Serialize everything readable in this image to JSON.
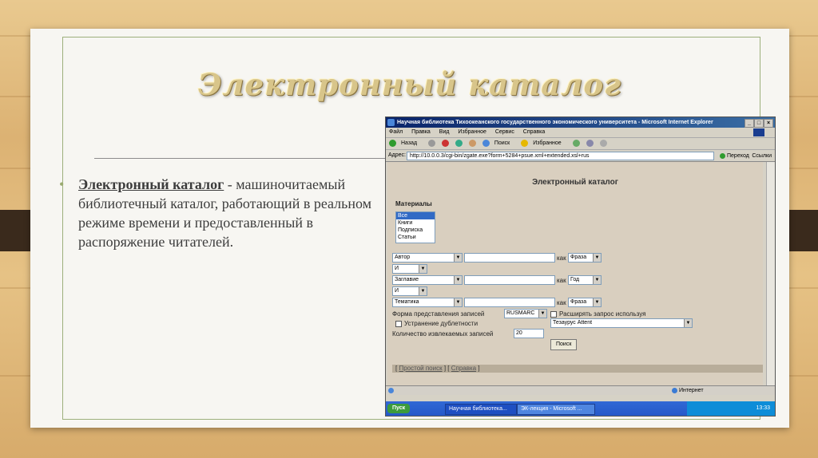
{
  "slide": {
    "title": "Электронный каталог",
    "bullet_term": "Электронный каталог",
    "bullet_text": " - машиночитаемый библиотечный каталог, работающий в реальном режиме времени и предоставленный в распоряжение читателей."
  },
  "browser": {
    "window_title": "Научная библиотека Тихоокеанского государственного экономического университета - Microsoft Internet Explorer",
    "window_buttons": [
      "_",
      "□",
      "×"
    ],
    "menu": [
      "Файл",
      "Правка",
      "Вид",
      "Избранное",
      "Сервис",
      "Справка"
    ],
    "toolbar": {
      "back": "Назад",
      "search": "Поиск",
      "favorites": "Избранное"
    },
    "address_label": "Адрес:",
    "address_value": "http://10.0.0.3/cgi-bin/zgate.exe?form+5284+psue.xml+extended.xsl+rus",
    "go_label": "Переход",
    "links_label": "Ссылки",
    "page": {
      "heading": "Электронный каталог",
      "materials_label": "Материалы",
      "materials": [
        "Все",
        "Книги",
        "Подписка",
        "Статьи"
      ],
      "field1": "Автор",
      "kak": "как",
      "mode1": "Фраза",
      "op1": "И",
      "field2": "Заглавие",
      "mode2": "Год",
      "op2": "И",
      "field3": "Тематика",
      "mode3": "Фраза",
      "format_label": "Форма представления записей",
      "format_value": "RUSMARC",
      "expand_label": "Расширять запрос используя",
      "thesaurus_value": "Тезаурус Attent",
      "dedupe_label": "Устранение дублетности",
      "count_label": "Количество извлекаемых записей",
      "count_value": "20",
      "search_button": "Поиск",
      "bottom_open": "[",
      "simple_search": "Простой поиск",
      "bottom_sep": "] [",
      "help_link": "Справка",
      "bottom_close": "]"
    },
    "status": {
      "internet": "Интернет"
    },
    "taskbar": {
      "start": "Пуск",
      "task1": "Научная библиотека...",
      "task2": "ЭК-лекция - Microsoft ...",
      "clock": "13:33"
    }
  }
}
